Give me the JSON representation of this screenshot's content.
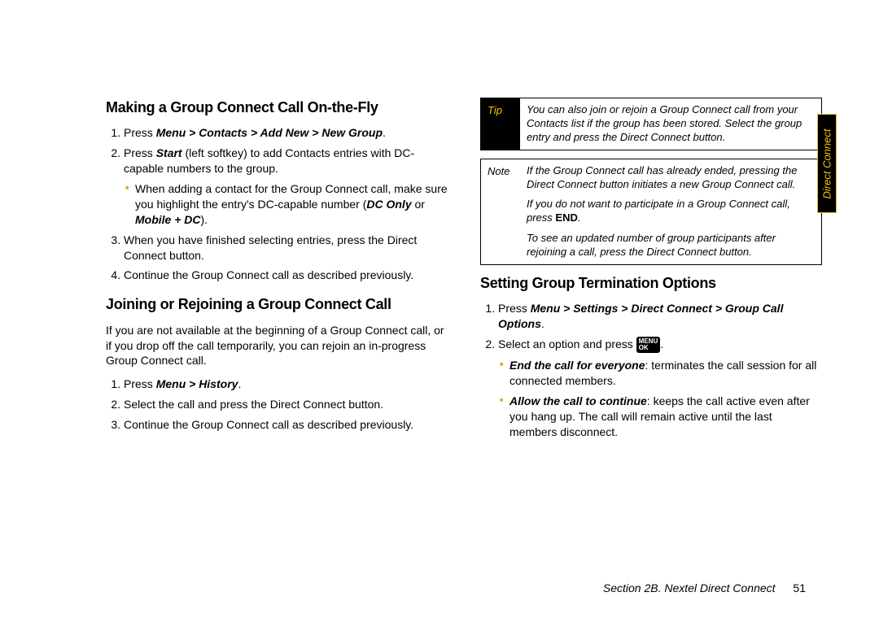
{
  "sideTab": "Direct Connect",
  "footer": {
    "section": "Section 2B. Nextel Direct Connect",
    "page": "51"
  },
  "left": {
    "h1": "Making a Group Connect Call On-the-Fly",
    "s1_pre": "Press ",
    "s1_bold": "Menu > Contacts > Add New > New Group",
    "s1_post": ".",
    "s2_pre": "Press ",
    "s2_bold": "Start",
    "s2_post": " (left softkey) to add Contacts entries with DC-capable numbers to the group.",
    "s2_sub_a": "When adding a contact for the Group Connect call, make sure you highlight the entry's DC-capable number (",
    "s2_sub_b": "DC Only",
    "s2_sub_c": " or ",
    "s2_sub_d": "Mobile + DC",
    "s2_sub_e": ").",
    "s3": "When you have finished selecting entries, press the Direct Connect button.",
    "s4": "Continue the Group Connect call as described previously.",
    "h2": "Joining or Rejoining a Group Connect Call",
    "p2": "If you are not available at the beginning of a Group Connect call, or if you drop off the call temporarily, you can rejoin an in-progress Group Connect call.",
    "j1_pre": "Press ",
    "j1_bold": "Menu > History",
    "j1_post": ".",
    "j2": "Select the call and press the Direct Connect button.",
    "j3": "Continue the Group Connect call as described previously."
  },
  "right": {
    "tipLabel": "Tip",
    "tip": "You can also join or rejoin a Group Connect call from your Contacts list if the group has been stored. Select the group entry and press the Direct Connect button.",
    "noteLabel": "Note",
    "note1": "If the Group Connect call has already ended, pressing the Direct Connect button initiates a new Group Connect call.",
    "note2a": "If you do not want to participate in a Group Connect call, press ",
    "note2b": "END",
    "note2c": ".",
    "note3": "To see an updated number of group participants after rejoining a call, press the Direct Connect button.",
    "h3": "Setting Group Termination Options",
    "t1_pre": "Press ",
    "t1_bold": "Menu > Settings > Direct Connect > Group Call Options",
    "t1_post": ".",
    "t2_pre": "Select an option and press ",
    "t2_post": ".",
    "keyTop": "MENU",
    "keyBot": "OK",
    "opt1_b": "End the call for everyone",
    "opt1_t": ": terminates the call session for all connected members.",
    "opt2_b": "Allow the call to continue",
    "opt2_t": ": keeps the call active even after you hang up. The call will remain active until the last members disconnect."
  }
}
